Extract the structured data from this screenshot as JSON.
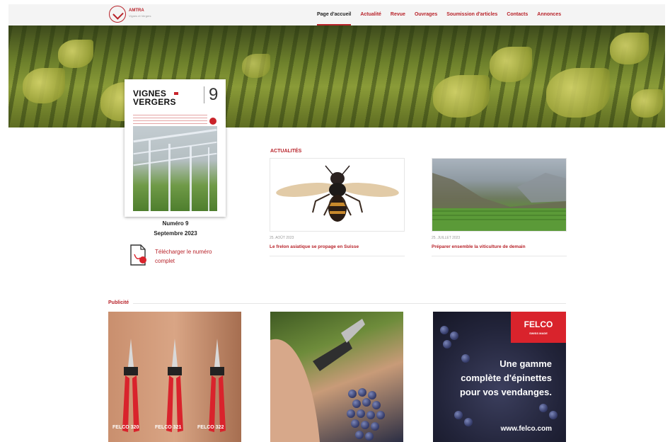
{
  "header": {
    "logo_name": "AMTRA",
    "logo_sub": "Vignes et Vergers",
    "nav": [
      {
        "label": "Page d'accueil",
        "active": true
      },
      {
        "label": "Actualité"
      },
      {
        "label": "Revue"
      },
      {
        "label": "Ouvrages"
      },
      {
        "label": "Soumission d'articles"
      },
      {
        "label": "Contacts"
      },
      {
        "label": "Annonces"
      }
    ]
  },
  "magazine": {
    "title_line1": "VIGNES",
    "title_line2": "VERGERS",
    "cover_number": "9",
    "number_label": "Numéro 9",
    "date_label": "Septembre 2023",
    "download_label": "Télécharger le numéro complet"
  },
  "news": {
    "section_label": "ACTUALITÉS",
    "items": [
      {
        "date": "25. AOÛT 2023",
        "title": "Le frelon asiatique se propage en Suisse",
        "image": "asian-hornet-photo"
      },
      {
        "date": "25. JUILLET 2023",
        "title": "Préparer ensemble la viticulture de demain",
        "image": "alpine-vineyard-photo"
      }
    ]
  },
  "ads": {
    "section_label": "Publicité",
    "ad1": {
      "models": [
        "FELCO 320",
        "FELCO 321",
        "FELCO 322"
      ]
    },
    "ad3": {
      "brand": "FELCO",
      "brand_sub": "SWISS MADE",
      "headline": [
        "Une gamme",
        "complète d'épinettes",
        "pour vos vendanges."
      ],
      "url": "www.felco.com"
    }
  },
  "colors": {
    "accent": "#b8232a",
    "felco_red": "#d9232c"
  }
}
